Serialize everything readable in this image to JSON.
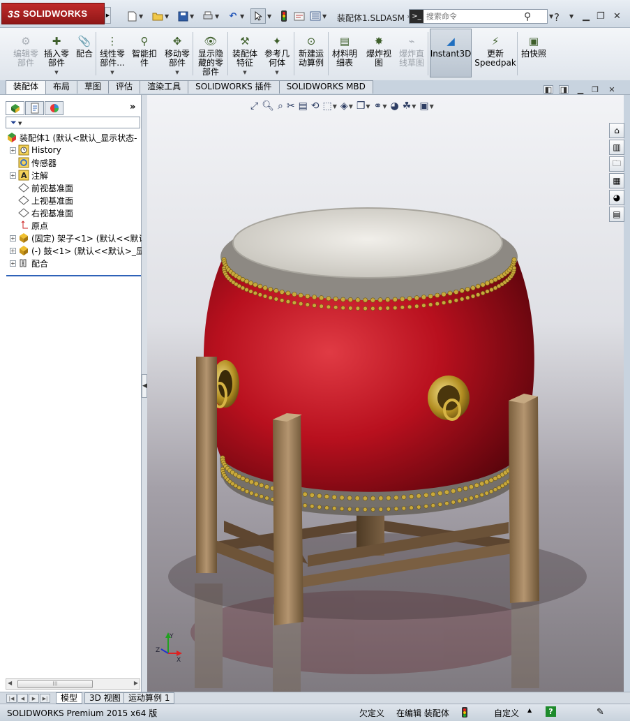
{
  "app": {
    "brand": "SOLIDWORKS",
    "brand_prefix": "3S",
    "document_title": "装配体1.SLDASM *",
    "search": {
      "placeholder": "搜索命令",
      "icon": "search-icon"
    },
    "help": "?"
  },
  "command_manager": {
    "buttons": [
      {
        "id": "edit-part",
        "label": "编辑零\n部件",
        "disabled": true,
        "icon": "edit-component-icon"
      },
      {
        "id": "insert-part",
        "label": "插入零\n部件",
        "dropdown": true,
        "icon": "insert-component-icon"
      },
      {
        "id": "mate",
        "label": "配合",
        "icon": "mate-icon"
      },
      {
        "id": "linear-pattern",
        "label": "线性零\n部件...",
        "dropdown": true,
        "icon": "linear-pattern-icon"
      },
      {
        "id": "smart-fastener",
        "label": "智能扣\n件",
        "icon": "smart-fastener-icon"
      },
      {
        "id": "move-part",
        "label": "移动零\n部件",
        "dropdown": true,
        "icon": "move-component-icon"
      },
      {
        "id": "show-hidden",
        "label": "显示隐\n藏的零\n部件",
        "icon": "show-hidden-icon"
      },
      {
        "id": "assembly-feature",
        "label": "装配体\n特征",
        "dropdown": true,
        "icon": "assembly-feature-icon"
      },
      {
        "id": "ref-geometry",
        "label": "参考几\n何体",
        "dropdown": true,
        "icon": "reference-geometry-icon"
      },
      {
        "id": "new-motion",
        "label": "新建运\n动算例",
        "icon": "motion-study-icon"
      },
      {
        "id": "bom",
        "label": "材料明\n细表",
        "icon": "bom-icon"
      },
      {
        "id": "exploded-view",
        "label": "爆炸视\n图",
        "icon": "exploded-view-icon"
      },
      {
        "id": "explode-line",
        "label": "爆炸直\n线草图",
        "disabled": true,
        "icon": "explode-line-icon"
      },
      {
        "id": "instant3d",
        "label": "Instant3D",
        "active": true,
        "icon": "instant3d-icon"
      },
      {
        "id": "speedpak",
        "label": "更新\nSpeedpak",
        "icon": "speedpak-icon"
      },
      {
        "id": "snapshot",
        "label": "拍快照",
        "icon": "snapshot-icon"
      }
    ],
    "tabs": [
      "装配体",
      "布局",
      "草图",
      "评估",
      "渲染工具",
      "SOLIDWORKS 插件",
      "SOLIDWORKS MBD"
    ],
    "active_tab": "装配体"
  },
  "panel": {
    "tree": [
      {
        "label": "装配体1  (默认<默认_显示状态-",
        "icon": "assembly-icon",
        "level": 0,
        "expand": false
      },
      {
        "label": "History",
        "icon": "history-icon",
        "level": 1,
        "expand": true
      },
      {
        "label": "传感器",
        "icon": "sensor-icon",
        "level": 1,
        "expand": false
      },
      {
        "label": "注解",
        "icon": "annotation-icon",
        "level": 1,
        "expand": true
      },
      {
        "label": "前视基准面",
        "icon": "plane-icon",
        "level": 1,
        "expand": false
      },
      {
        "label": "上视基准面",
        "icon": "plane-icon",
        "level": 1,
        "expand": false
      },
      {
        "label": "右视基准面",
        "icon": "plane-icon",
        "level": 1,
        "expand": false
      },
      {
        "label": "原点",
        "icon": "origin-icon",
        "level": 1,
        "expand": false
      },
      {
        "label": "(固定) 架子<1> (默认<<默认",
        "icon": "part-icon",
        "level": 1,
        "expand": true
      },
      {
        "label": "(-) 鼓<1> (默认<<默认>_显",
        "icon": "part-icon",
        "level": 1,
        "expand": true
      },
      {
        "label": "配合",
        "icon": "mates-folder-icon",
        "level": 1,
        "expand": true
      }
    ]
  },
  "bottom_tabs": [
    "模型",
    "3D 视图",
    "运动算例 1"
  ],
  "active_bottom_tab": "模型",
  "status": {
    "product": "SOLIDWORKS Premium 2015 x64 版",
    "definition": "欠定义",
    "editing": "在编辑 装配体",
    "units": "自定义"
  },
  "colors": {
    "drum_body": "#b8101e",
    "drum_head": "#e4e2dc",
    "stud": "#c9a93c",
    "stand_wood": "#9c7f5c",
    "brand_red": "#b42222"
  }
}
